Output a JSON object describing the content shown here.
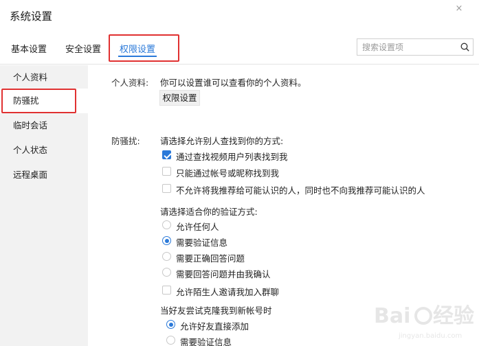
{
  "window": {
    "title": "系统设置",
    "close_glyph": "×"
  },
  "tabs": [
    {
      "label": "基本设置",
      "active": false
    },
    {
      "label": "安全设置",
      "active": false
    },
    {
      "label": "权限设置",
      "active": true
    }
  ],
  "search": {
    "placeholder": "搜索设置项",
    "value": ""
  },
  "sidebar": {
    "items": [
      {
        "label": "个人资料",
        "active": false
      },
      {
        "label": "防骚扰",
        "active": true
      },
      {
        "label": "临时会话",
        "active": false
      },
      {
        "label": "个人状态",
        "active": false
      },
      {
        "label": "远程桌面",
        "active": false
      }
    ]
  },
  "profile": {
    "label": "个人资料:",
    "description": "你可以设置谁可以查看你的个人资料。",
    "button": "权限设置"
  },
  "anti_harass": {
    "label": "防骚扰:",
    "find_prompt": "请选择允许别人查找到你的方式:",
    "find_options": [
      {
        "label": "通过查找视频用户列表找到我",
        "checked": true
      },
      {
        "label": "只能通过帐号或昵称找到我",
        "checked": false
      },
      {
        "label": "不允许将我推荐给可能认识的人，同时也不向我推荐可能认识的人",
        "checked": false
      }
    ],
    "verify_prompt": "请选择适合你的验证方式:",
    "verify_options": [
      {
        "label": "允许任何人",
        "selected": false
      },
      {
        "label": "需要验证信息",
        "selected": true
      },
      {
        "label": "需要正确回答问题",
        "selected": false
      },
      {
        "label": "需要回答问题并由我确认",
        "selected": false
      }
    ],
    "group_invite": {
      "label": "允许陌生人邀请我加入群聊",
      "checked": false
    },
    "clone_prompt": "当好友尝试克隆我到新帐号时",
    "clone_options": [
      {
        "label": "允许好友直接添加",
        "selected": true
      },
      {
        "label": "需要验证信息",
        "selected": false
      }
    ]
  },
  "colors": {
    "accent": "#2a79d9",
    "highlight": "#e03030",
    "sidebar_bg": "#f2f2f2"
  },
  "icons": {
    "close": "close-icon",
    "search": "search-icon"
  }
}
